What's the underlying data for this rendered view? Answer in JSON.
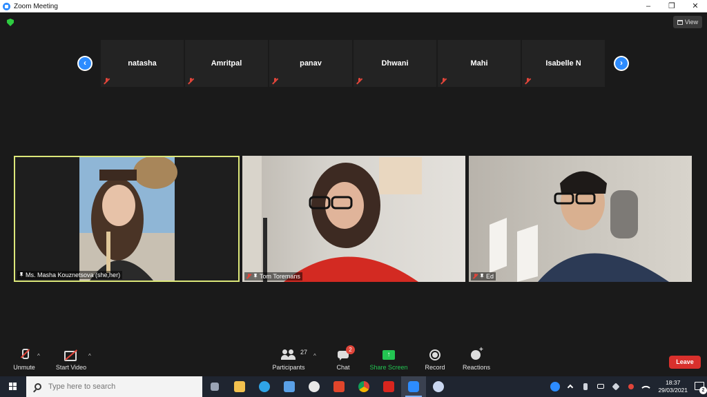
{
  "window": {
    "title": "Zoom Meeting",
    "controls": {
      "minimize": "–",
      "restore": "❐",
      "close": "✕"
    }
  },
  "meeting": {
    "view_label": "View",
    "nav": {
      "prev": "‹",
      "next": "›"
    },
    "strip_participants": [
      {
        "name": "natasha"
      },
      {
        "name": "Amritpal"
      },
      {
        "name": "panav"
      },
      {
        "name": "Dhwani"
      },
      {
        "name": "Mahi"
      },
      {
        "name": "Isabelle N"
      }
    ],
    "videos": [
      {
        "name": "Ms. Masha Kouznetsova (she,her)"
      },
      {
        "name": "Tom Toremans"
      },
      {
        "name": "Ed"
      }
    ],
    "active_speaker_color": "#dde87a"
  },
  "toolbar": {
    "unmute_label": "Unmute",
    "start_video_label": "Start Video",
    "participants_label": "Participants",
    "participants_count": "27",
    "chat_label": "Chat",
    "chat_badge": "2",
    "share_screen_label": "Share Screen",
    "record_label": "Record",
    "reactions_label": "Reactions",
    "leave_label": "Leave",
    "caret": "^"
  },
  "taskbar": {
    "search_placeholder": "Type here to search",
    "time": "18:37",
    "date": "29/03/2021",
    "notification_count": "2",
    "apps": [
      {
        "name": "task-view-icon",
        "color": "#9aa4b5"
      },
      {
        "name": "file-explorer-icon",
        "color": "#f2c14e"
      },
      {
        "name": "edge-icon",
        "color": "#2fa4e7"
      },
      {
        "name": "store-icon",
        "color": "#5aa0e6"
      },
      {
        "name": "paint-icon",
        "color": "#e8e8e8"
      },
      {
        "name": "office-icon",
        "color": "#e0452b"
      },
      {
        "name": "chrome-icon",
        "color": "#4caf50"
      },
      {
        "name": "acrobat-icon",
        "color": "#d8251e"
      },
      {
        "name": "zoom-icon",
        "color": "#2d8cff"
      },
      {
        "name": "paint3d-icon",
        "color": "#c9d7f0"
      }
    ]
  }
}
